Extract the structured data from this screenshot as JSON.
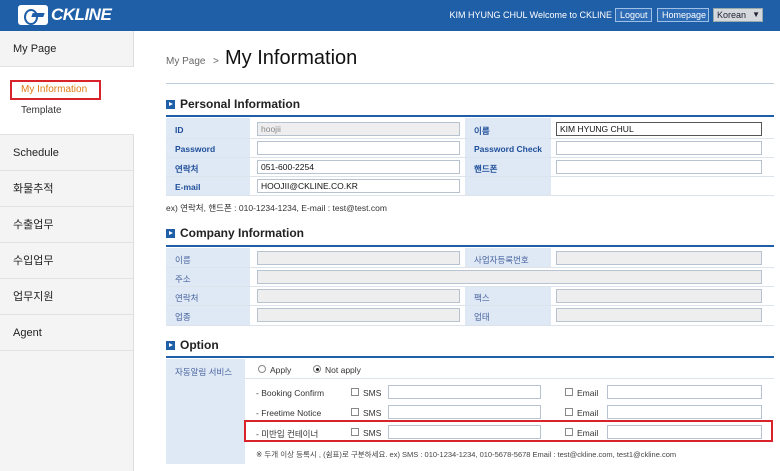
{
  "header": {
    "logo_text": "CKLINE",
    "user_text": "KIM HYUNG CHUL  Welcome to CKLINE",
    "logout": "Logout",
    "homepage": "Homepage",
    "language": "Korean"
  },
  "sidebar": {
    "my_page": "My Page",
    "my_information": "My Information",
    "template": "Template",
    "items": [
      "Schedule",
      "화물추적",
      "수출업무",
      "수입업무",
      "업무지원",
      "Agent"
    ]
  },
  "breadcrumb": {
    "parent": "My Page",
    "sep": ">"
  },
  "page_title": "My Information",
  "personal": {
    "title": "Personal Information",
    "id_label": "ID",
    "id_value": "hoojii",
    "name_label": "이름",
    "name_value": "KIM HYUNG CHUL",
    "password_label": "Password",
    "password_check_label": "Password Check",
    "phone_label": "연락처",
    "phone_value": "051-600-2254",
    "mobile_label": "핸드폰",
    "email_label": "E-mail",
    "email_value": "HOOJII@CKLINE.CO.KR",
    "hint": "ex) 연락처, 핸드폰 : 010-1234-1234,   E-mail : test@test.com"
  },
  "company": {
    "title": "Company Information",
    "name_label": "이름",
    "biz_no_label": "사업자등록번호",
    "address_label": "주소",
    "phone_label": "연락처",
    "fax_label": "팩스",
    "type_label": "업종",
    "category_label": "업태"
  },
  "option": {
    "title": "Option",
    "service_label": "자동알림 서비스",
    "apply": "Apply",
    "not_apply": "Not apply",
    "rows": [
      {
        "name": "- Booking Confirm",
        "sms": "SMS",
        "email": "Email"
      },
      {
        "name": "- Freetime Notice",
        "sms": "SMS",
        "email": "Email"
      },
      {
        "name": "- 미반입 컨테이너",
        "sms": "SMS",
        "email": "Email"
      }
    ],
    "footnote": "※ 두개 이상 등록시 , (쉼표)로 구분하세요. ex) SMS : 010-1234-1234, 010-5678-5678   Email : test@ckline.com, test1@ckline.com"
  }
}
